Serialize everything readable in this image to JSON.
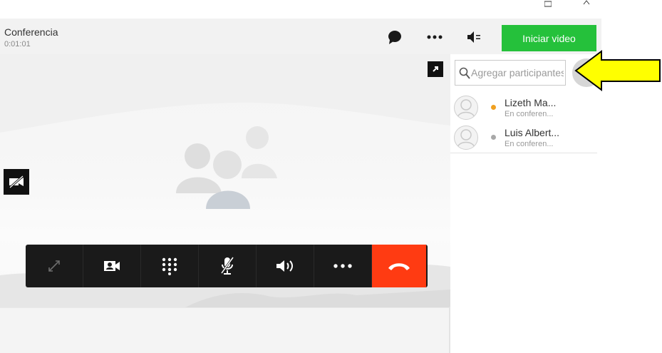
{
  "window": {
    "minimize_icon": "minimize-icon",
    "close_icon": "close-icon"
  },
  "header": {
    "title": "Conferencia",
    "timer": "0:01:01",
    "video_button_label": "Iniciar video",
    "icons": [
      "chat-icon",
      "more-icon",
      "speaker-settings-icon"
    ]
  },
  "stage": {
    "expand_icon": "expand-icon",
    "camera_off_icon": "camera-off-icon",
    "placeholder_icon": "group-icon"
  },
  "toolbar": {
    "buttons": [
      "fullscreen-icon",
      "video-camera-icon",
      "keypad-icon",
      "mic-muted-icon",
      "volume-icon",
      "more-icon",
      "hangup-icon"
    ]
  },
  "sidebar": {
    "search_placeholder": "Agregar participantes",
    "participants": [
      {
        "name": "Lizeth Ma...",
        "status": "En conferen...",
        "status_color": "#f0a020"
      },
      {
        "name": "Luis Albert...",
        "status": "En conferen...",
        "status_color": "#a8a8a8"
      }
    ]
  },
  "colors": {
    "accent_green": "#25c13b",
    "hangup_red": "#ff3b12",
    "toolbar_bg": "#1a1a1a",
    "annotation_yellow": "#ffff00"
  }
}
